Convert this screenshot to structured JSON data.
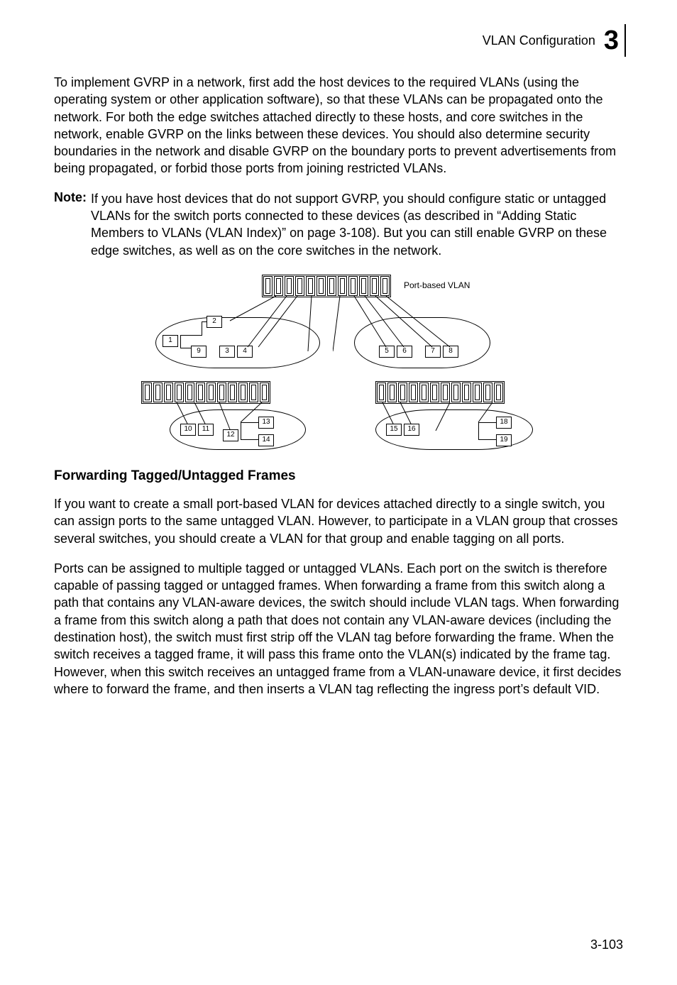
{
  "header": {
    "title": "VLAN Configuration",
    "chapter": "3"
  },
  "paragraphs": {
    "p1": "To implement GVRP in a network, first add the host devices to the required VLANs (using the operating system or other application software), so that these VLANs can be propagated onto the network. For both the edge switches attached directly to these hosts, and core switches in the network, enable GVRP on the links between these devices. You should also determine security boundaries in the network and disable GVRP on the boundary ports to prevent advertisements from being propagated, or forbid those ports from joining restricted VLANs."
  },
  "note": {
    "label": "Note:",
    "text": "If you have host devices that do not support GVRP, you should configure static or untagged VLANs for the switch ports connected to these devices (as described in “Adding Static Members to VLANs (VLAN Index)” on page 3-108). But you can still enable GVRP on these edge switches, as well as on the core switches in the network."
  },
  "diagram": {
    "label": "Port-based VLAN",
    "ports": {
      "p1": "1",
      "p2": "2",
      "p3": "3",
      "p4": "4",
      "p5": "5",
      "p6": "6",
      "p7": "7",
      "p8": "8",
      "p9": "9",
      "p10": "10",
      "p11": "11",
      "p12": "12",
      "p13": "13",
      "p14": "14",
      "p15": "15",
      "p16": "16",
      "p18": "18",
      "p19": "19"
    }
  },
  "section": {
    "heading": "Forwarding Tagged/Untagged Frames",
    "p2": "If you want to create a small port-based VLAN for devices attached directly to a single switch, you can assign ports to the same untagged VLAN. However, to participate in a VLAN group that crosses several switches, you should create a VLAN for that group and enable tagging on all ports.",
    "p3": "Ports can be assigned to multiple tagged or untagged VLANs. Each port on the switch is therefore capable of passing tagged or untagged frames. When forwarding a frame from this switch along a path that contains any VLAN-aware devices, the switch should include VLAN tags. When forwarding a frame from this switch along a path that does not contain any VLAN-aware devices (including the destination host), the switch must first strip off the VLAN tag before forwarding the frame. When the switch receives a tagged frame, it will pass this frame onto the VLAN(s) indicated by the frame tag. However, when this switch receives an untagged frame from a VLAN-unaware device, it first decides where to forward the frame, and then inserts a VLAN tag reflecting the ingress port’s default VID."
  },
  "pageNumber": "3-103"
}
